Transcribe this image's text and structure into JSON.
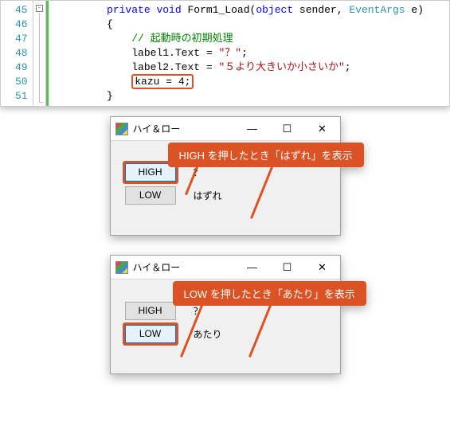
{
  "code": {
    "line_numbers": [
      "45",
      "46",
      "47",
      "48",
      "49",
      "50",
      "51"
    ],
    "decl": {
      "kw1": "private",
      "kw2": "void",
      "method": "Form1_Load",
      "args_open": "(",
      "kw3": "object",
      "arg1": " sender, ",
      "type": "EventArgs",
      "arg2": " e)"
    },
    "brace_open": "{",
    "comment": "// 起動時の初期処理",
    "l1a": "label1.Text = ",
    "l1s": "\"？\"",
    "l1b": ";",
    "l2a": "label2.Text = ",
    "l2s": "\"５より大きいか小さいか\"",
    "l2b": ";",
    "kazu": "kazu = 4;",
    "brace_close": "}",
    "fold_glyph": "-"
  },
  "win1": {
    "title": "ハイ＆ロー",
    "btn_high": "HIGH",
    "btn_low": "LOW",
    "q": "？",
    "result": "はずれ",
    "callout": "HIGH を押したとき「はずれ」を表示",
    "min": "—",
    "max": "☐",
    "close": "✕"
  },
  "win2": {
    "title": "ハイ＆ロー",
    "btn_high": "HIGH",
    "btn_low": "LOW",
    "q": "？",
    "result": "あたり",
    "callout": "LOW を押したとき「あたり」を表示",
    "min": "—",
    "max": "☐",
    "close": "✕"
  }
}
